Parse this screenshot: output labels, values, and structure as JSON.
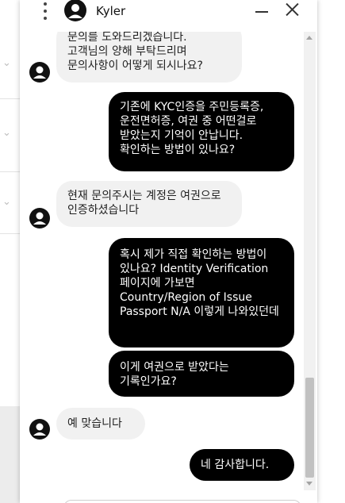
{
  "header": {
    "agent_name": "Kyler"
  },
  "messages": [
    {
      "from": "agent",
      "text": "문의를 도와드리겠습니다. 고객님의 양해 부탁드리며 문의사항이 어떻게 되시나요?"
    },
    {
      "from": "user",
      "text": "기존에 KYC인증을 주민등록증, 운전면허증, 여권 중 어떤걸로 받았는지 기억이 안납니다. 확인하는 방법이 있나요?"
    },
    {
      "from": "agent",
      "text": "현재 문의주시는 계정은 여권으로 인증하셨습니다"
    },
    {
      "from": "user",
      "text": "혹시 제가 직접 확인하는 방법이 있나요? Identity Verification 페이지에 가보면 Country/Region of Issue Passport N/A 이렇게 나와있던데"
    },
    {
      "from": "user",
      "text": "이게 여권으로 받았다는 기록인가요?"
    },
    {
      "from": "agent",
      "text": "예 맞습니다"
    },
    {
      "from": "user",
      "text": "네 감사합니다."
    }
  ],
  "icons": {
    "menu": "kebab-menu-icon",
    "avatar": "user-avatar-icon",
    "minimize": "minimize-icon",
    "close": "close-icon",
    "background_rows": "chevron-down-icon"
  },
  "colors": {
    "user_bubble": "#000000",
    "agent_bubble": "#f1f1f1",
    "user_text": "#ffffff",
    "agent_text": "#222222"
  }
}
